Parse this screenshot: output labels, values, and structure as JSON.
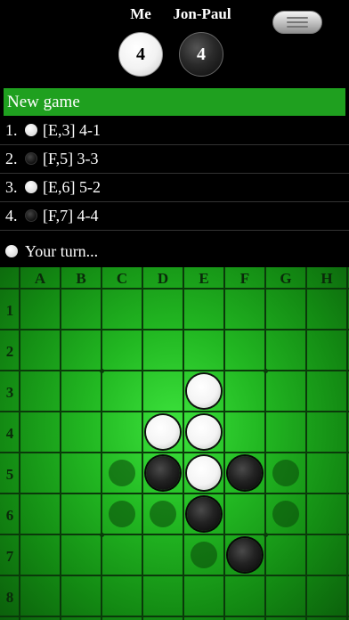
{
  "players": {
    "me": {
      "name": "Me",
      "score": "4",
      "color": "white"
    },
    "opponent": {
      "name": "Jon-Paul",
      "score": "4",
      "color": "black"
    }
  },
  "menu": {
    "icon": "hamburger-menu-icon"
  },
  "moves": {
    "new_game_label": "New game",
    "list": [
      {
        "num": "1.",
        "disc": "white",
        "text": "[E,3] 4-1"
      },
      {
        "num": "2.",
        "disc": "black",
        "text": "[F,5] 3-3"
      },
      {
        "num": "3.",
        "disc": "white",
        "text": "[E,6] 5-2"
      },
      {
        "num": "4.",
        "disc": "black",
        "text": "[F,7] 4-4"
      }
    ]
  },
  "status": {
    "disc": "white",
    "text": "Your turn..."
  },
  "board": {
    "columns": [
      "A",
      "B",
      "C",
      "D",
      "E",
      "F",
      "G",
      "H"
    ],
    "rows": [
      "1",
      "2",
      "3",
      "4",
      "5",
      "6",
      "7",
      "8"
    ],
    "colors": {
      "board": "#22b822",
      "grid": "#0a3a0a"
    },
    "pieces": [
      {
        "col": "E",
        "row": "3",
        "color": "white"
      },
      {
        "col": "D",
        "row": "4",
        "color": "white"
      },
      {
        "col": "E",
        "row": "4",
        "color": "white"
      },
      {
        "col": "D",
        "row": "5",
        "color": "black"
      },
      {
        "col": "E",
        "row": "5",
        "color": "white"
      },
      {
        "col": "F",
        "row": "5",
        "color": "black"
      },
      {
        "col": "E",
        "row": "6",
        "color": "black"
      },
      {
        "col": "F",
        "row": "7",
        "color": "black"
      }
    ],
    "hints": [
      {
        "col": "C",
        "row": "5"
      },
      {
        "col": "G",
        "row": "5"
      },
      {
        "col": "C",
        "row": "6"
      },
      {
        "col": "D",
        "row": "6"
      },
      {
        "col": "G",
        "row": "6"
      },
      {
        "col": "E",
        "row": "7"
      }
    ]
  }
}
